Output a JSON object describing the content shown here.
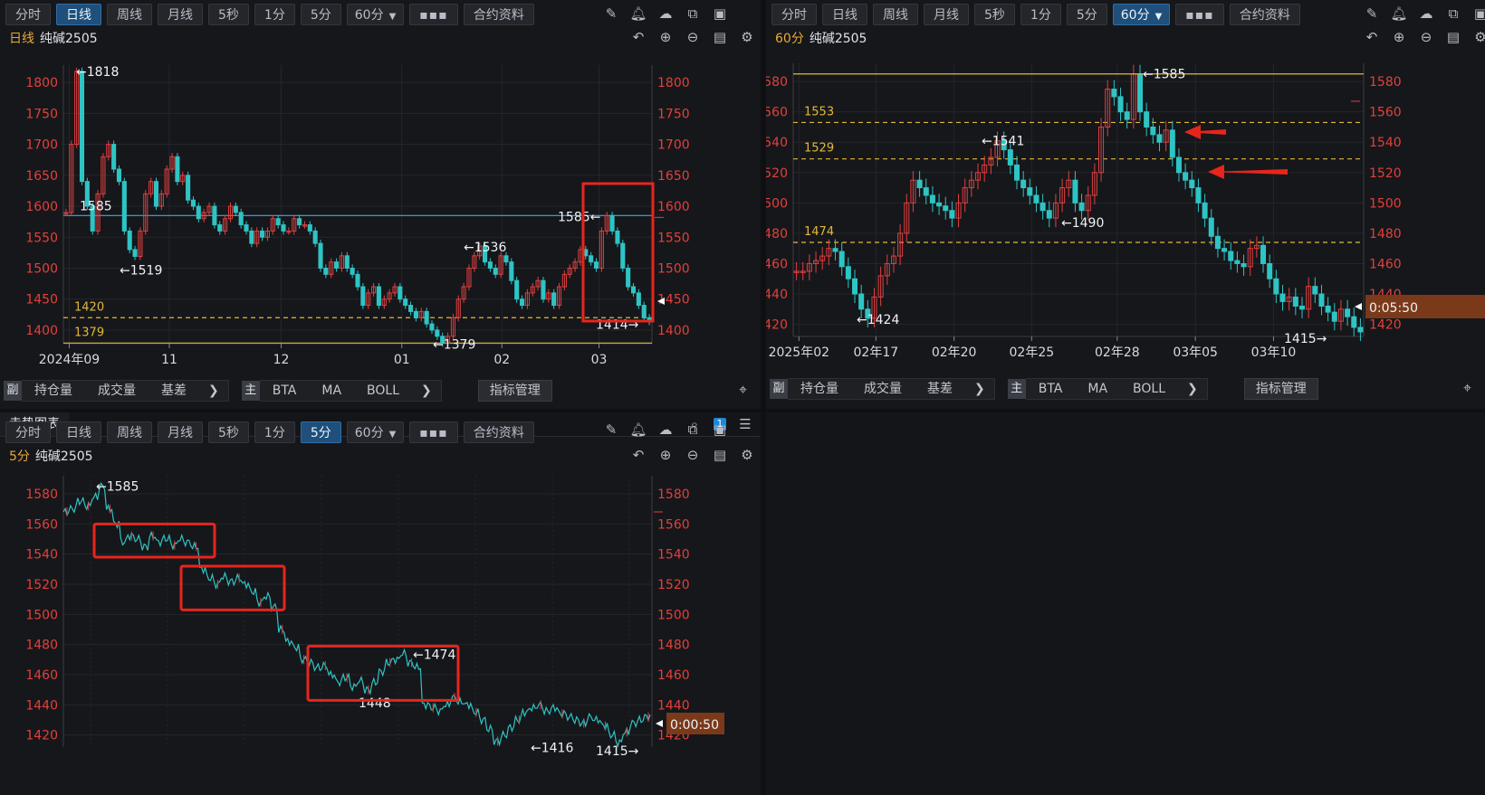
{
  "toolbar": {
    "buttons": [
      "分时",
      "日线",
      "周线",
      "月线",
      "5秒",
      "1分",
      "5分"
    ],
    "select_60": "60分",
    "more": "▪▪▪",
    "contract": "合约资料"
  },
  "panels": {
    "p1": {
      "active": "日线",
      "period": "日线",
      "symbol": "纯碱2505"
    },
    "p2": {
      "active": "60分",
      "period": "60分",
      "symbol": "纯碱2505"
    },
    "p3": {
      "active": "5分",
      "period": "5分",
      "symbol": "纯碱2505"
    }
  },
  "bottom": {
    "fu": "副",
    "fu_items": [
      "持仓量",
      "成交量",
      "基差"
    ],
    "zhu": "主",
    "zhu_items": [
      "BTA",
      "MA",
      "BOLL"
    ],
    "arrow": "❯",
    "manage": "指标管理"
  },
  "panel3_header": {
    "title": "走势图表",
    "badge": "1"
  },
  "chart_data": [
    {
      "type": "candlestick",
      "title": "日线 纯碱2505",
      "yticks": [
        1400,
        1450,
        1500,
        1550,
        1600,
        1650,
        1700,
        1750,
        1800
      ],
      "ylim": [
        1378,
        1828
      ],
      "xticks": [
        "2024年09",
        "11",
        "12",
        "01",
        "02",
        "03"
      ],
      "annotations": {
        "high": "←1818",
        "low1": "←1519",
        "mid": "←1536",
        "peak": "1585←",
        "end": "1414→",
        "low2": "←1379",
        "hline_label": "1585"
      },
      "hlines": [
        {
          "label": "1420",
          "value": 1420,
          "style": "dashed",
          "color": "#e2b93a"
        },
        {
          "label": "1379",
          "value": 1379,
          "style": "solid",
          "color": "#e2b93a"
        },
        {
          "label": "1585",
          "value": 1585,
          "style": "solid",
          "color": "#3fa9e0"
        }
      ],
      "closes": [
        1590,
        1700,
        1818,
        1640,
        1600,
        1560,
        1620,
        1680,
        1700,
        1660,
        1640,
        1560,
        1530,
        1519,
        1560,
        1620,
        1640,
        1600,
        1620,
        1660,
        1680,
        1640,
        1650,
        1610,
        1600,
        1580,
        1590,
        1600,
        1570,
        1560,
        1580,
        1600,
        1590,
        1570,
        1560,
        1540,
        1560,
        1550,
        1560,
        1580,
        1570,
        1560,
        1560,
        1580,
        1570,
        1570,
        1560,
        1540,
        1500,
        1490,
        1510,
        1500,
        1520,
        1500,
        1490,
        1470,
        1440,
        1460,
        1470,
        1440,
        1450,
        1460,
        1470,
        1450,
        1440,
        1430,
        1420,
        1430,
        1410,
        1400,
        1390,
        1379,
        1390,
        1420,
        1450,
        1470,
        1500,
        1520,
        1536,
        1510,
        1500,
        1490,
        1520,
        1510,
        1480,
        1450,
        1440,
        1460,
        1470,
        1480,
        1450,
        1460,
        1440,
        1470,
        1490,
        1500,
        1510,
        1530,
        1520,
        1510,
        1500,
        1560,
        1585,
        1560,
        1540,
        1500,
        1470,
        1460,
        1440,
        1420,
        1414
      ]
    },
    {
      "type": "candlestick",
      "title": "60分 纯碱2505",
      "yticks": [
        1420,
        1440,
        1460,
        1480,
        1500,
        1520,
        1540,
        1560,
        1580
      ],
      "ylim": [
        1412,
        1592
      ],
      "xticks": [
        "2025年02",
        "02年17",
        "02年20",
        "02年25",
        "02年28",
        "03年05",
        "03年10"
      ],
      "annotations": {
        "high": "←1585",
        "mid": "←1541",
        "low": "←1490",
        "low2": "←1424",
        "end": "1415→",
        "timer": "0:05:50"
      },
      "hlines": [
        {
          "label": "1553",
          "value": 1553,
          "style": "dashed",
          "color": "#e2b93a"
        },
        {
          "label": "1529",
          "value": 1529,
          "style": "dashed",
          "color": "#e2b93a"
        },
        {
          "label": "1474",
          "value": 1474,
          "style": "dashed",
          "color": "#e2b93a"
        }
      ],
      "closes": [
        1455,
        1455,
        1460,
        1462,
        1465,
        1470,
        1468,
        1458,
        1450,
        1440,
        1430,
        1424,
        1438,
        1452,
        1460,
        1465,
        1480,
        1500,
        1515,
        1510,
        1505,
        1500,
        1498,
        1495,
        1490,
        1500,
        1510,
        1515,
        1520,
        1525,
        1530,
        1541,
        1535,
        1525,
        1515,
        1510,
        1505,
        1500,
        1495,
        1490,
        1500,
        1510,
        1515,
        1500,
        1495,
        1505,
        1520,
        1550,
        1575,
        1570,
        1560,
        1555,
        1585,
        1560,
        1550,
        1545,
        1540,
        1548,
        1530,
        1520,
        1515,
        1510,
        1500,
        1490,
        1478,
        1470,
        1468,
        1462,
        1460,
        1458,
        1470,
        1472,
        1460,
        1450,
        1440,
        1435,
        1438,
        1432,
        1430,
        1445,
        1440,
        1432,
        1428,
        1422,
        1430,
        1425,
        1418,
        1415
      ]
    },
    {
      "type": "line",
      "title": "5分 纯碱2505",
      "yticks": [
        1420,
        1440,
        1460,
        1480,
        1500,
        1520,
        1540,
        1560,
        1580
      ],
      "ylim": [
        1412,
        1592
      ],
      "annotations": {
        "high": "←1585",
        "box_high": "←1474",
        "box_low": "1448",
        "low": "←1416",
        "end": "1415→",
        "timer": "0:00:50"
      },
      "boxes": [
        {
          "from": 1538,
          "to": 1560
        },
        {
          "from": 1503,
          "to": 1532
        },
        {
          "from": 1443,
          "to": 1479
        }
      ],
      "series": [
        {
          "values": [
            1568,
            1570,
            1575,
            1572,
            1578,
            1585,
            1570,
            1560,
            1548,
            1552,
            1550,
            1545,
            1552,
            1548,
            1550,
            1546,
            1550,
            1548,
            1545,
            1530,
            1524,
            1520,
            1525,
            1522,
            1524,
            1520,
            1515,
            1508,
            1512,
            1505,
            1490,
            1482,
            1478,
            1470,
            1468,
            1465,
            1466,
            1460,
            1455,
            1458,
            1452,
            1456,
            1450,
            1455,
            1462,
            1468,
            1470,
            1474,
            1468,
            1465,
            1440,
            1438,
            1436,
            1440,
            1445,
            1442,
            1440,
            1435,
            1430,
            1424,
            1416,
            1420,
            1425,
            1430,
            1435,
            1438,
            1440,
            1436,
            1438,
            1434,
            1432,
            1430,
            1428,
            1432,
            1430,
            1426,
            1420,
            1415,
            1422,
            1428,
            1430,
            1432
          ]
        }
      ]
    }
  ]
}
